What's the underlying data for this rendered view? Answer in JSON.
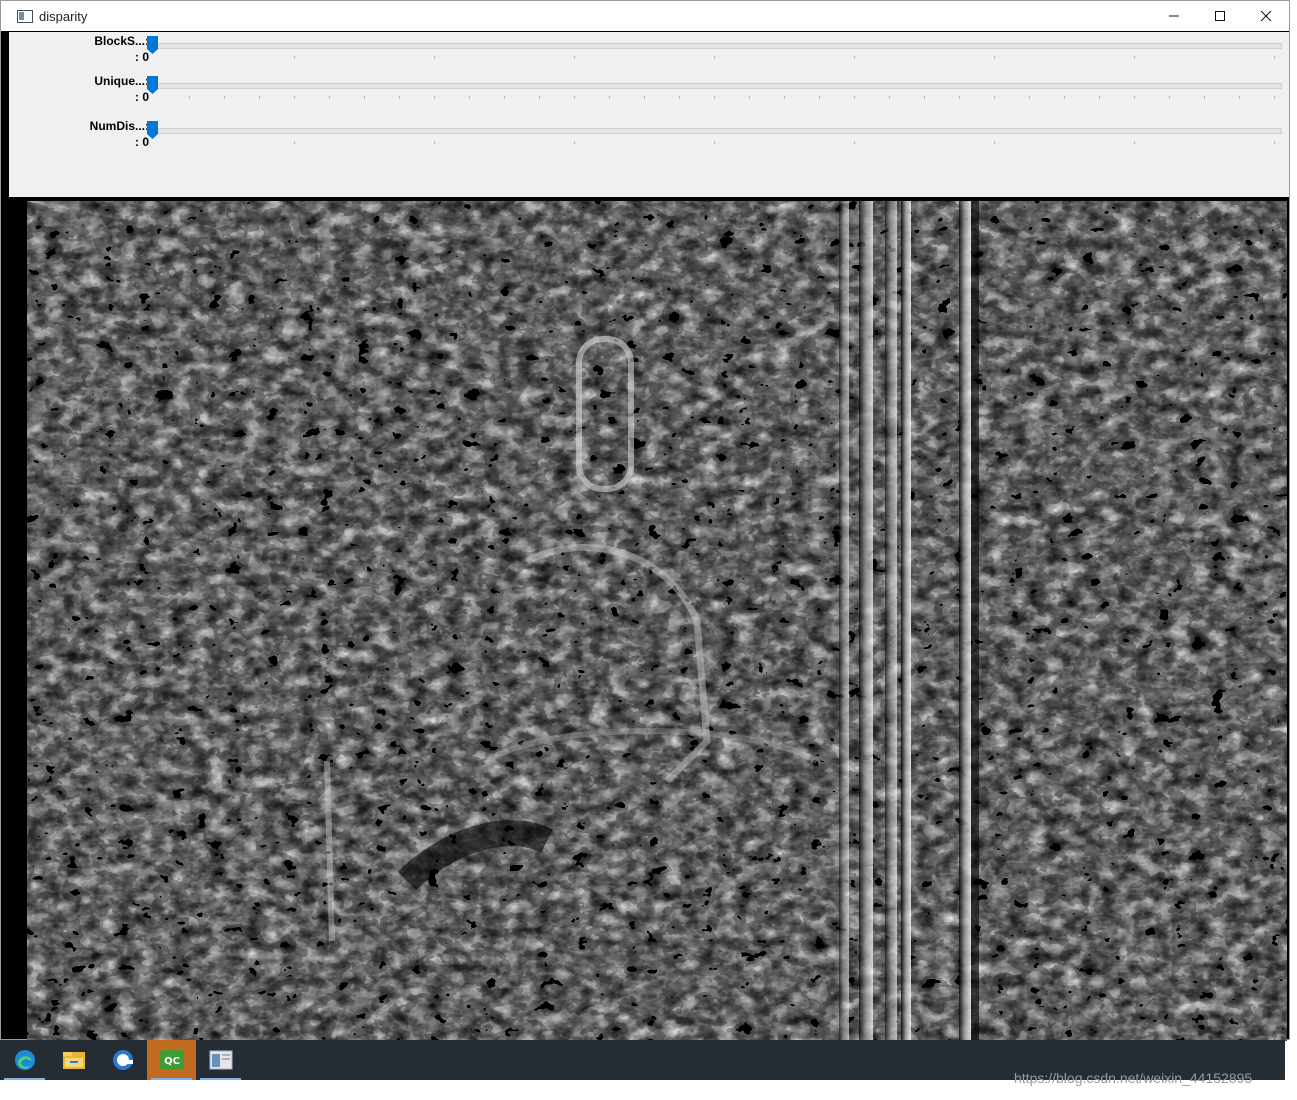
{
  "window": {
    "title": "disparity",
    "icon": "app-window-icon",
    "controls": {
      "minimize": "minimize-icon",
      "maximize": "maximize-icon",
      "close": "close-icon"
    }
  },
  "trackbars": [
    {
      "name": "BlockS...:",
      "value": ": 0",
      "level": 0
    },
    {
      "name": "Unique...:",
      "value": ": 0",
      "level": 0
    },
    {
      "name": "NumDis...:",
      "value": ": 0",
      "level": 0
    }
  ],
  "image": {
    "description": "disparity-map",
    "colors": {
      "background": "#000000",
      "foreground": "#ffffff"
    }
  },
  "taskbar": {
    "apps": [
      {
        "icon": "edge-browser-icon",
        "active": false
      },
      {
        "icon": "file-explorer-icon",
        "active": false
      },
      {
        "icon": "edge-beta-icon",
        "active": false
      },
      {
        "icon": "qt-creator-icon",
        "label": "QC",
        "active": true
      },
      {
        "icon": "window-app-icon",
        "active": false
      }
    ]
  },
  "watermark": "https://blog.csdn.net/weixin_44152895",
  "colors": {
    "accent": "#0078d7",
    "toolbar_bg": "#f0f0f0",
    "taskbar_bg": "#262c34",
    "active_app": "#c26a20"
  }
}
